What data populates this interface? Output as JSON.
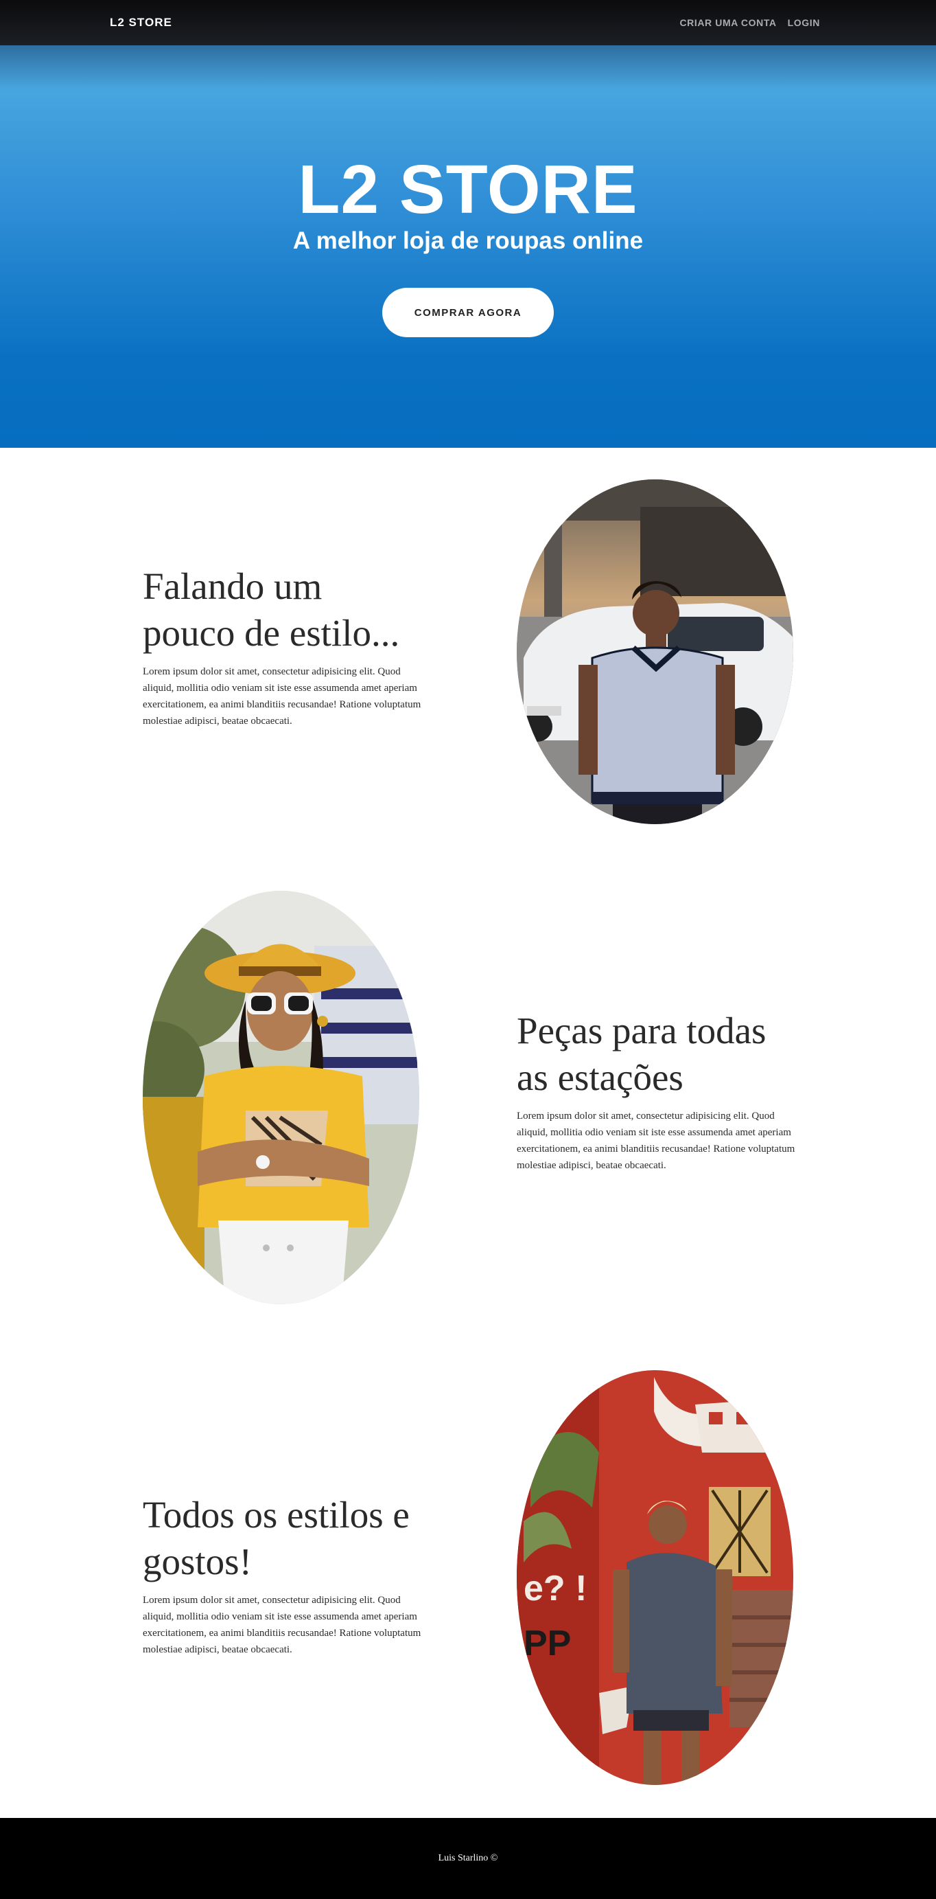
{
  "navbar": {
    "brand": "L2 STORE",
    "links": [
      "CRIAR UMA CONTA",
      "LOGIN"
    ]
  },
  "hero": {
    "title": "L2 STORE",
    "subtitle": "A melhor loja de roupas online",
    "button_label": "COMPRAR AGORA"
  },
  "features": [
    {
      "title_line1": "Falando um",
      "title_line2": "pouco de estilo...",
      "text": "Lorem ipsum dolor sit amet, consectetur adipisicing elit. Quod aliquid, mollitia odio veniam sit iste esse assumenda amet aperiam exercitationem, ea animi blanditiis recusandae! Ratione voluptatum molestiae adipisci, beatae obcaecati."
    },
    {
      "title_line1": "Peças para todas",
      "title_line2": "as estações",
      "text": "Lorem ipsum dolor sit amet, consectetur adipisicing elit. Quod aliquid, mollitia odio veniam sit iste esse assumenda amet aperiam exercitationem, ea animi blanditiis recusandae! Ratione voluptatum molestiae adipisci, beatae obcaecati."
    },
    {
      "title_line1": "Todos os estilos e",
      "title_line2": "gostos!",
      "text": "Lorem ipsum dolor sit amet, consectetur adipisicing elit. Quod aliquid, mollitia odio veniam sit iste esse assumenda amet aperiam exercitationem, ea animi blanditiis recusandae! Ratione voluptatum molestiae adipisci, beatae obcaecati."
    }
  ],
  "footer": {
    "text": "Luis Starlino ©"
  },
  "colors": {
    "hero_top": "#47a5de",
    "hero_bottom": "#066dbf",
    "navbar": "#0b0b0d",
    "footer": "#000000"
  }
}
